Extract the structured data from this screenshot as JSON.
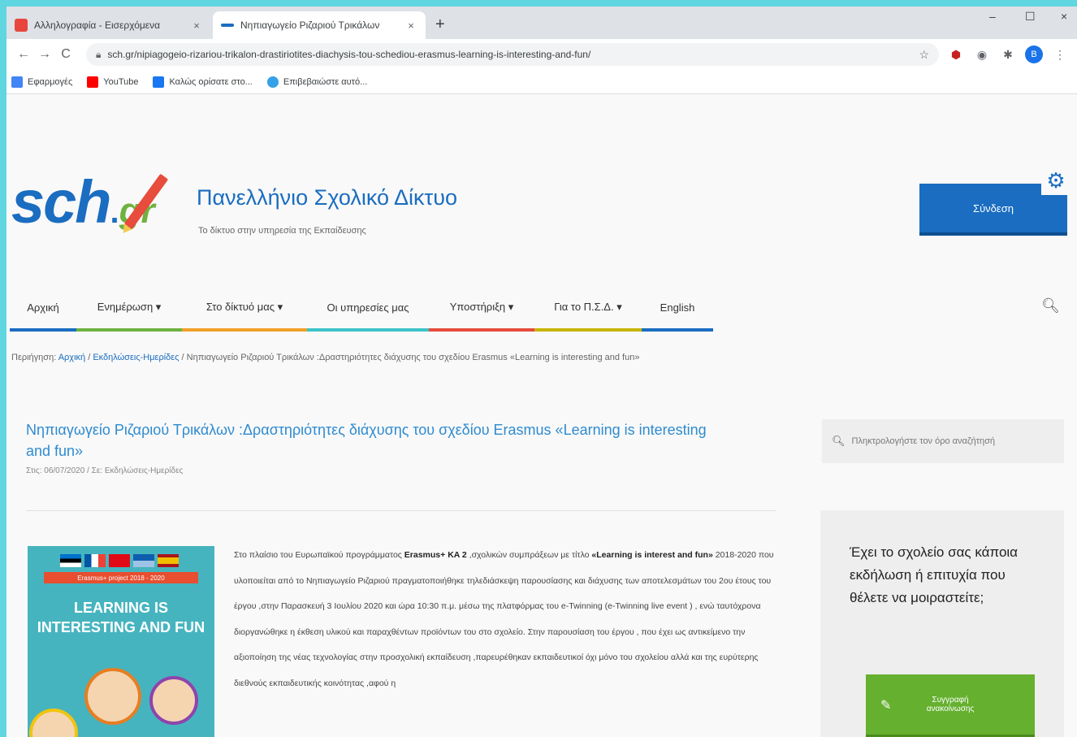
{
  "browser": {
    "tabs": [
      {
        "title": "Αλληλογραφία - Εισερχόμενα",
        "close": "×"
      },
      {
        "title": "Νηπιαγωγείο Ριζαριού Τρικάλων",
        "close": "×"
      }
    ],
    "new_tab": "+",
    "window_controls": {
      "minimize": "–",
      "maximize": "☐",
      "close": "×"
    },
    "nav": {
      "back": "←",
      "forward": "→",
      "reload": "C"
    },
    "url": "sch.gr/nipiagogeio-rizariou-trikalon-drastiriotites-diachysis-tou-schediou-erasmus-learning-is-interesting-and-fun/",
    "profile_initial": "B",
    "bookmarks": [
      {
        "label": "Εφαρμογές",
        "color": "#4285f4"
      },
      {
        "label": "YouTube",
        "color": "#ff0000"
      },
      {
        "label": "Καλώς ορίσατε στο...",
        "color": "#1877f2"
      },
      {
        "label": "Επιβεβαιώστε αυτό...",
        "color": "#34a1e8"
      }
    ]
  },
  "header": {
    "logo_main": "sch",
    "logo_dot": ".",
    "logo_suffix": "gr",
    "title": "Πανελλήνιο Σχολικό Δίκτυο",
    "tagline": "Το δίκτυο στην υπηρεσία της Εκπαίδευσης",
    "login_label": "Σύνδεση"
  },
  "menu": {
    "items": [
      {
        "label": "Αρχική",
        "color": "#1a6dc0"
      },
      {
        "label": "Ενημέρωση ▾",
        "color": "#6fb23f"
      },
      {
        "label": "Στο δίκτυό μας ▾",
        "color": "#f0a028"
      },
      {
        "label": "Οι υπηρεσίες μας",
        "color": "#3cc3c8"
      },
      {
        "label": "Υποστήριξη ▾",
        "color": "#e74c3c"
      },
      {
        "label": "Για το Π.Σ.Δ. ▾",
        "color": "#c8b400"
      },
      {
        "label": "English",
        "color": "#1a6dc0"
      }
    ]
  },
  "breadcrumb": {
    "prefix": "Περιήγηση:",
    "home": "Αρχική",
    "sep": " / ",
    "category": "Εκδηλώσεις-Ημερίδες",
    "current": "Νηπιαγωγείο Ριζαριού Τρικάλων :Δραστηριότητες διάχυσης του σχεδίου Erasmus «Learning is interesting and fun»"
  },
  "article": {
    "title": "Νηπιαγωγείο Ριζαριού Τρικάλων :Δραστηριότητες διάχυσης του σχεδίου Erasmus «Learning is interesting and fun»",
    "meta": "Στις: 06/07/2020 / Σε: Εκδηλώσεις-Ημερίδες",
    "cover": {
      "banner": "Erasmus+ project 2018 - 2020",
      "line1": "LEARNING IS",
      "line2": "INTERESTING AND FUN"
    },
    "paragraph": {
      "p1": "Στο πλαίσιο του Ευρωπαϊκού προγράμματος ",
      "b1": "Erasmus+ KA 2",
      "p2": " ,σχολικών συμπράξεων με τίτλο ",
      "b2": "«Learning is interest and fun»",
      "p3": " 2018-2020 που υλοποιείται από το Νηπιαγωγείο Ριζαριού πραγματοποιήθηκε τηλεδιάσκεψη παρουσίασης και διάχυσης των αποτελεσμάτων του 2ου έτους του έργου ,στην Παρασκευή 3 Ιουλίου 2020 και ώρα 10:30 π.μ. μέσω της πλατφόρμας του e-Twinning (e-Twinning live event ) , ενώ ταυτόχρονα διοργανώθηκε η έκθεση υλικού και παραχθέντων προϊόντων του στο σχολείο. Στην παρουσίαση του έργου , που έχει ως αντικείμενο την αξιοποίηση της νέας τεχνολογίας στην προσχολική εκπαίδευση ,παρευρέθηκαν εκπαιδευτικοί όχι μόνο του σχολείου αλλά και της ευρύτερης διεθνούς εκπαιδευτικής κοινότητας ,αφού η"
    }
  },
  "sidebar": {
    "search_placeholder": "Πληκτρολογήστε τον όρο αναζήτησή",
    "card_question": "Έχει το σχολείο σας κάποια εκδήλωση ή επιτυχία που θέλετε να μοιραστείτε;",
    "card_button": "Συγγραφή ανακοίνωσης"
  }
}
